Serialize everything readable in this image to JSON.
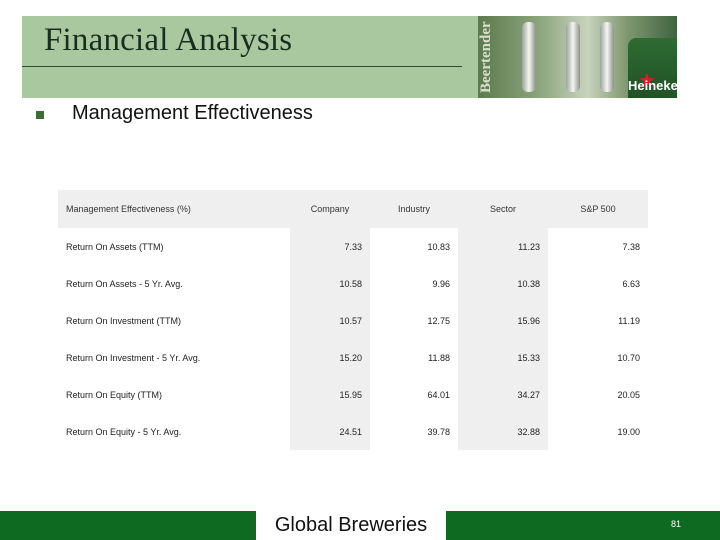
{
  "slide": {
    "title": "Financial Analysis",
    "bullet": "Management Effectiveness",
    "header_image": {
      "brand_vertical": "Beertender",
      "brand_keg": "Heineken"
    }
  },
  "table": {
    "columns": [
      "Management Effectiveness (%)",
      "Company",
      "Industry",
      "Sector",
      "S&P 500"
    ],
    "rows": [
      {
        "label": "Return On Assets (TTM)",
        "company": "7.33",
        "industry": "10.83",
        "sector": "11.23",
        "sp500": "7.38"
      },
      {
        "label": "Return On Assets - 5 Yr. Avg.",
        "company": "10.58",
        "industry": "9.96",
        "sector": "10.38",
        "sp500": "6.63"
      },
      {
        "label": "Return On Investment (TTM)",
        "company": "10.57",
        "industry": "12.75",
        "sector": "15.96",
        "sp500": "11.19"
      },
      {
        "label": "Return On Investment - 5 Yr. Avg.",
        "company": "15.20",
        "industry": "11.88",
        "sector": "15.33",
        "sp500": "10.70"
      },
      {
        "label": "Return On Equity (TTM)",
        "company": "15.95",
        "industry": "64.01",
        "sector": "34.27",
        "sp500": "20.05"
      },
      {
        "label": "Return On Equity - 5 Yr. Avg.",
        "company": "24.51",
        "industry": "39.78",
        "sector": "32.88",
        "sp500": "19.00"
      }
    ]
  },
  "footer": {
    "label": "Global Breweries",
    "page_number": "81"
  },
  "colors": {
    "header_band": "#a9c8a0",
    "footer_band": "#0d6a20",
    "bullet": "#3d6b34",
    "table_shade": "#efefef"
  }
}
